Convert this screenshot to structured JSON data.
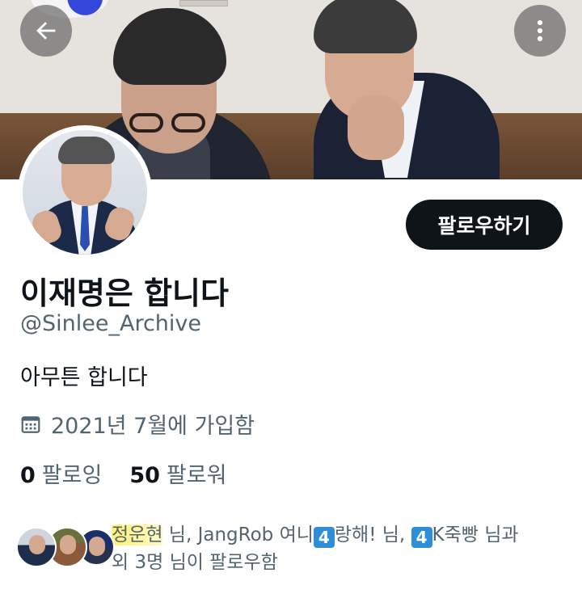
{
  "header": {
    "back_icon": "arrow-left-icon",
    "more_icon": "more-vertical-icon"
  },
  "profile": {
    "display_name": "이재명은 합니다",
    "handle": "@Sinlee_Archive",
    "bio": "아무튼 합니다",
    "joined_icon": "calendar-icon",
    "joined": "2021년 7월에 가입함",
    "following_count": "0",
    "following_label": "팔로잉",
    "followers_count": "50",
    "followers_label": "팔로워",
    "follow_button_label": "팔로우하기"
  },
  "followed_by": {
    "names": [
      {
        "name": "정운현",
        "suffix": " 님, "
      },
      {
        "name": "JangRob 여니",
        "badge": "4",
        "rest": "랑해!",
        "suffix": " 님, "
      },
      {
        "badge": "4",
        "rest": "K죽빵",
        "suffix": " 님과"
      }
    ],
    "line2": "외 3명 님이 팔로우함"
  },
  "colors": {
    "text_primary": "#0f1419",
    "text_secondary": "#536471",
    "button_bg": "#0f1419",
    "badge_blue": "#2f8ed8",
    "highlight": "#fff05a"
  }
}
